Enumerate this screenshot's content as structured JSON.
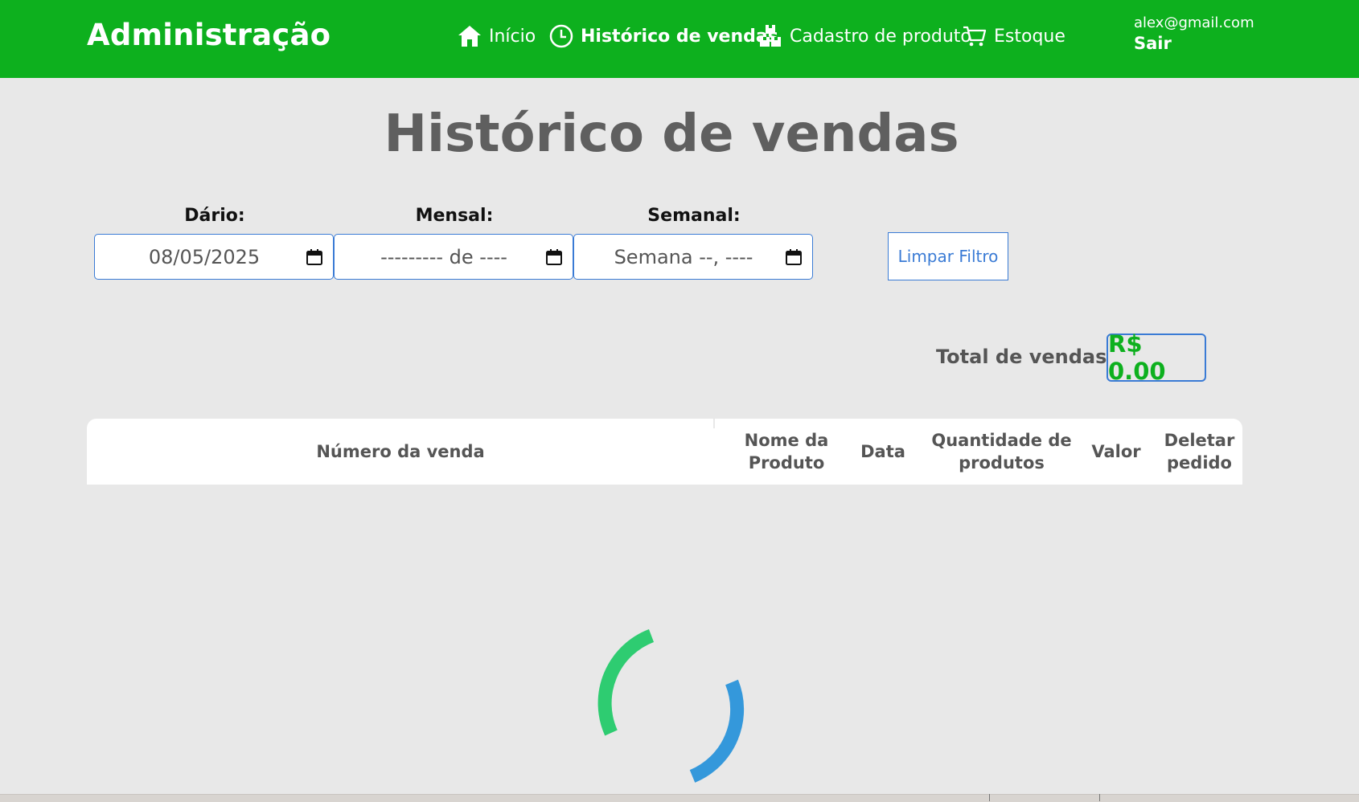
{
  "header": {
    "brand": "Administração",
    "nav": [
      {
        "label": "Início",
        "icon": "home-icon",
        "active": false
      },
      {
        "label": "Histórico de vendas",
        "icon": "clock-icon",
        "active": true
      },
      {
        "label": "Cadastro de produto",
        "icon": "boxes-icon",
        "active": false
      },
      {
        "label": "Estoque",
        "icon": "cart-icon",
        "active": false
      }
    ],
    "user_email": "alex@gmail.com",
    "logout_label": "Sair"
  },
  "page": {
    "title": "Histórico de vendas"
  },
  "filters": {
    "daily": {
      "label": "Dário:",
      "value": "08/05/2025"
    },
    "monthly": {
      "label": "Mensal:",
      "value": "--------- de ----"
    },
    "weekly": {
      "label": "Semanal:",
      "value": "Semana --, ----"
    },
    "clear_label": "Limpar Filtro"
  },
  "summary": {
    "total_label": "Total de vendas:",
    "total_value": "R$ 0.00"
  },
  "table": {
    "columns": [
      "Número da venda",
      "Nome da Produto",
      "Data",
      "Quantidade de produtos",
      "Valor",
      "Deletar pedido"
    ]
  },
  "colors": {
    "brand_green": "#0db01e",
    "accent_blue": "#3a7bd5",
    "spinner_green": "#2ecc71",
    "spinner_blue": "#3498db"
  }
}
